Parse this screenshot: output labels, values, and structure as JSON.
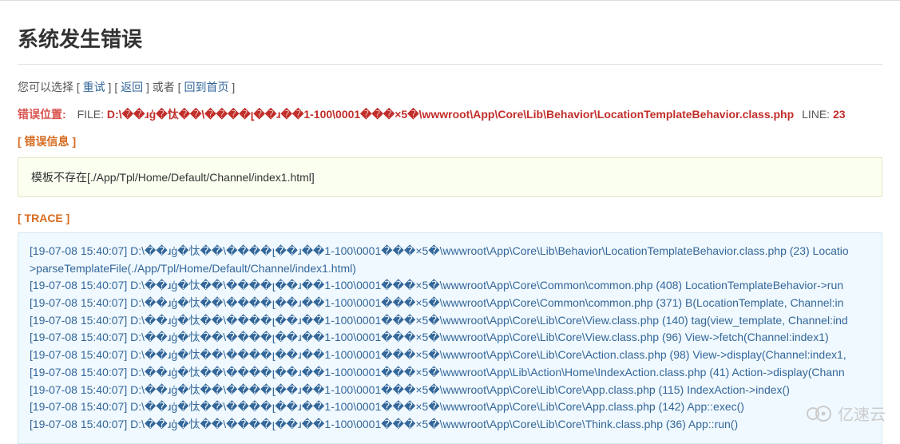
{
  "title": "系统发生错误",
  "options": {
    "prefix": "您可以选择 [ ",
    "retry": "重试",
    "sep1": " ] [ ",
    "back": "返回",
    "sep2": " ] 或者 [ ",
    "home": "回到首页",
    "suffix": " ]"
  },
  "error_location": {
    "label": "错误位置:",
    "file_label": "FILE: ",
    "file_path": "D:\\��ɹģ�忲��\\����լ��ɹ��1-100\\0001���×5�\\wwwroot\\App\\Core\\Lib\\Behavior\\LocationTemplateBehavior.class.php",
    "line_label": "LINE: ",
    "line_num": "23"
  },
  "error_info": {
    "label": "[ 错误信息 ]",
    "message": "模板不存在[./App/Tpl/Home/Default/Channel/index1.html]"
  },
  "trace": {
    "label": "[ TRACE ]",
    "lines": [
      "[19-07-08 15:40:07] D:\\��ɹģ�忲��\\����լ��ɹ��1-100\\0001���×5�\\wwwroot\\App\\Core\\Lib\\Behavior\\LocationTemplateBehavior.class.php (23) Locatio",
      ">parseTemplateFile(./App/Tpl/Home/Default/Channel/index1.html)",
      "[19-07-08 15:40:07] D:\\��ɹģ�忲��\\����լ��ɹ��1-100\\0001���×5�\\wwwroot\\App\\Core\\Common\\common.php (408) LocationTemplateBehavior->run",
      "[19-07-08 15:40:07] D:\\��ɹģ�忲��\\����լ��ɹ��1-100\\0001���×5�\\wwwroot\\App\\Core\\Common\\common.php (371) B(LocationTemplate, Channel:in",
      "[19-07-08 15:40:07] D:\\��ɹģ�忲��\\����լ��ɹ��1-100\\0001���×5�\\wwwroot\\App\\Core\\Lib\\Core\\View.class.php (140) tag(view_template, Channel:ind",
      "[19-07-08 15:40:07] D:\\��ɹģ�忲��\\����լ��ɹ��1-100\\0001���×5�\\wwwroot\\App\\Core\\Lib\\Core\\View.class.php (96) View->fetch(Channel:index1)",
      "[19-07-08 15:40:07] D:\\��ɹģ�忲��\\����լ��ɹ��1-100\\0001���×5�\\wwwroot\\App\\Core\\Lib\\Core\\Action.class.php (98) View->display(Channel:index1,",
      "[19-07-08 15:40:07] D:\\��ɹģ�忲��\\����լ��ɹ��1-100\\0001���×5�\\wwwroot\\App\\Lib\\Action\\Home\\IndexAction.class.php (41) Action->display(Chann",
      "[19-07-08 15:40:07] D:\\��ɹģ�忲��\\����լ��ɹ��1-100\\0001���×5�\\wwwroot\\App\\Core\\Lib\\Core\\App.class.php (115) IndexAction->index()",
      "[19-07-08 15:40:07] D:\\��ɹģ�忲��\\����լ��ɹ��1-100\\0001���×5�\\wwwroot\\App\\Core\\Lib\\Core\\App.class.php (142) App::exec()",
      "[19-07-08 15:40:07] D:\\��ɹģ�忲��\\����լ��ɹ��1-100\\0001���×5�\\wwwroot\\App\\Core\\Lib\\Core\\Think.class.php (36) App::run()"
    ]
  },
  "watermark": "亿速云"
}
